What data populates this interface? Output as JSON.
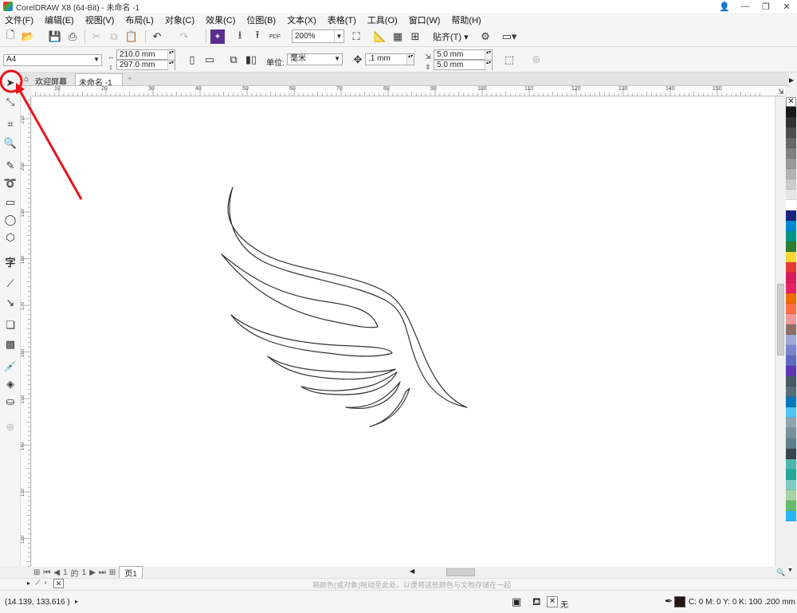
{
  "window": {
    "title": "CorelDRAW X8 (64-Bit) - 未命名 -1",
    "controls": [
      "👤",
      "—",
      "❐",
      "✕"
    ]
  },
  "menu": [
    "文件(F)",
    "编辑(E)",
    "视图(V)",
    "布局(L)",
    "对象(C)",
    "效果(C)",
    "位图(B)",
    "文本(X)",
    "表格(T)",
    "工具(O)",
    "窗口(W)",
    "帮助(H)"
  ],
  "toolbar": {
    "zoom": "200%",
    "snap_label": "贴齐(T)",
    "pdf_label": "PDF"
  },
  "property_bar": {
    "page_size": "A4",
    "width": "210.0 mm",
    "height": "297.0 mm",
    "unit_label": "单位:",
    "unit_value": "毫米",
    "nudge": ".1 mm",
    "dup_x": "5.0 mm",
    "dup_y": "5.0 mm"
  },
  "doc_tabs": {
    "welcome": "欢迎屏幕",
    "document": "未命名 -1",
    "add": "+"
  },
  "ruler": {
    "h_ticks": [
      "10",
      "20",
      "30",
      "40",
      "50",
      "60",
      "70",
      "80",
      "90",
      "100",
      "110",
      "120",
      "130",
      "140",
      "150"
    ],
    "v_ticks": [
      "210",
      "200",
      "190",
      "180",
      "170",
      "160",
      "150",
      "140",
      "130",
      "120"
    ]
  },
  "page_nav": {
    "current": "1",
    "of_label": "的",
    "total": "1",
    "page_tab": "页1"
  },
  "doc_palette": {
    "hint": "将颜色(或对象)拖动至此处，以便将这些颜色与文档存储在一起"
  },
  "status": {
    "coords": "(14.139, 133.616 )",
    "fill_label": "无",
    "outline": "C: 0 M: 0 Y: 0 K: 100  .200 mm",
    "outline_color": "#231815"
  },
  "palette_colors": [
    "#1a1a1a",
    "#333333",
    "#4d4d4d",
    "#666666",
    "#808080",
    "#999999",
    "#b3b3b3",
    "#cccccc",
    "#e6e6e6",
    "#ffffff",
    "#1a237e",
    "#0288d1",
    "#009688",
    "#2e7d32",
    "#fdd835",
    "#e53935",
    "#d81b60",
    "#e91e63",
    "#ef6c00",
    "#ff7043",
    "#ef9a9a",
    "#8d6e63",
    "#9fa8da",
    "#7986cb",
    "#5c6bc0",
    "#5e35b1",
    "#455a64",
    "#546e7a",
    "#0277bd",
    "#4fc3f7",
    "#90a4ae",
    "#78909c",
    "#607d8b",
    "#37474f",
    "#4db6ac",
    "#26a69a",
    "#80cbc4",
    "#a5d6a7",
    "#66bb6a",
    "#29b6f6"
  ]
}
